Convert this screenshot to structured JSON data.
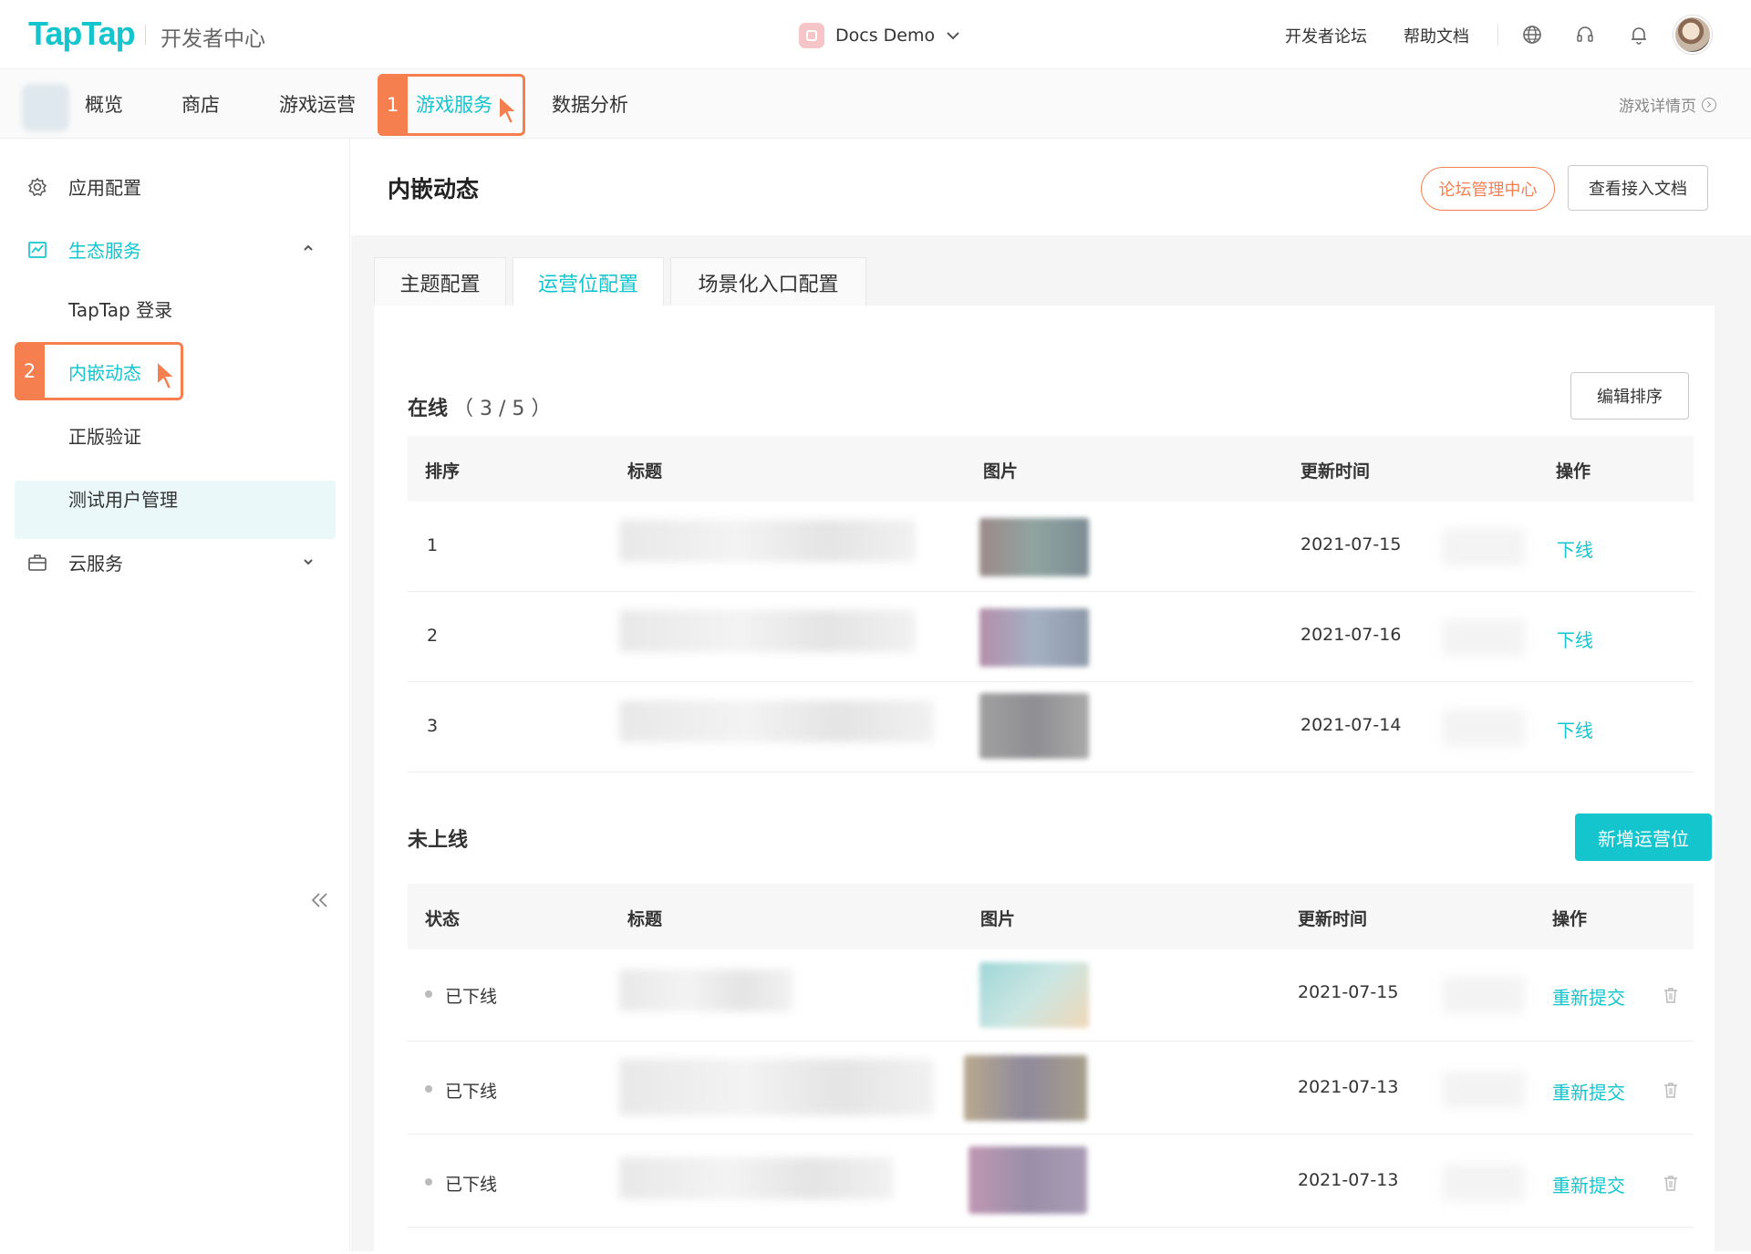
{
  "header": {
    "logo": "TapTap",
    "portal_title": "开发者中心",
    "app_name": "Docs Demo",
    "links": [
      "开发者论坛",
      "帮助文档"
    ],
    "icons": [
      "globe-icon",
      "headset-icon",
      "bell-icon"
    ]
  },
  "nav": {
    "items": [
      "概览",
      "商店",
      "游戏运营",
      "游戏服务",
      "数据分析"
    ],
    "active": "游戏服务",
    "right_link": "游戏详情页"
  },
  "annotations": {
    "step1": "1",
    "step2": "2"
  },
  "sidebar": {
    "app_config": "应用配置",
    "eco_services": "生态服务",
    "sub_items": [
      "TapTap 登录",
      "内嵌动态",
      "正版验证",
      "测试用户管理"
    ],
    "active_sub": "内嵌动态",
    "cloud_services": "云服务"
  },
  "page": {
    "title": "内嵌动态",
    "forum_center_button": "论坛管理中心",
    "docs_button": "查看接入文档",
    "tabs": [
      "主题配置",
      "运营位配置",
      "场景化入口配置"
    ],
    "active_tab": "运营位配置"
  },
  "online": {
    "title": "在线",
    "count": "（ 3 / 5 ）",
    "edit_sort_button": "编辑排序",
    "columns": [
      "排序",
      "标题",
      "图片",
      "更新时间",
      "操作"
    ],
    "rows": [
      {
        "order": "1",
        "date": "2021-07-15",
        "action": "下线"
      },
      {
        "order": "2",
        "date": "2021-07-16",
        "action": "下线"
      },
      {
        "order": "3",
        "date": "2021-07-14",
        "action": "下线"
      }
    ]
  },
  "offline": {
    "title": "未上线",
    "add_button": "新增运营位",
    "columns": [
      "状态",
      "标题",
      "图片",
      "更新时间",
      "操作"
    ],
    "rows": [
      {
        "status": "已下线",
        "date": "2021-07-15",
        "action": "重新提交"
      },
      {
        "status": "已下线",
        "date": "2021-07-13",
        "action": "重新提交"
      },
      {
        "status": "已下线",
        "date": "2021-07-13",
        "action": "重新提交"
      }
    ]
  },
  "colors": {
    "accent": "#15c5ce",
    "highlight": "#f57f4f",
    "active_bg": "#eaf8f9"
  }
}
